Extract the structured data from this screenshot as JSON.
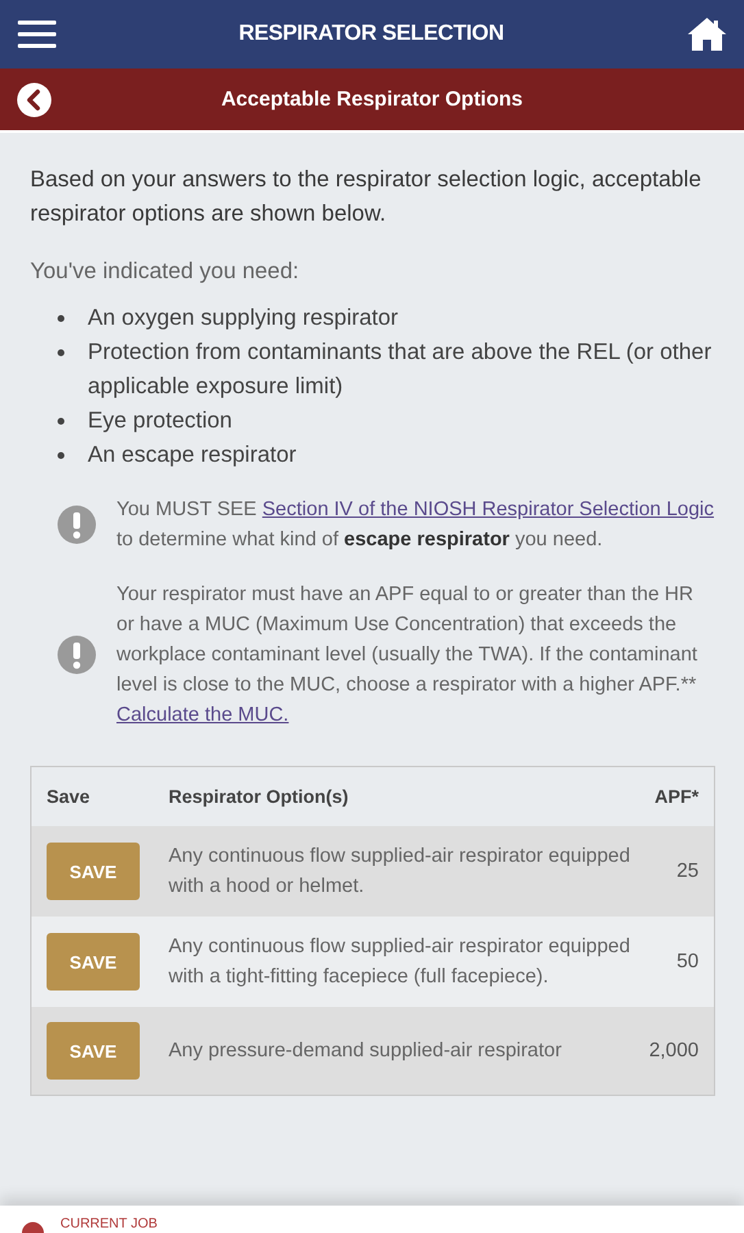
{
  "header": {
    "title": "RESPIRATOR SELECTION"
  },
  "subheader": {
    "title": "Acceptable Respirator Options"
  },
  "intro": "Based on your answers to the respirator selection logic, acceptable respirator options are shown below.",
  "needs_label": "You've indicated you need:",
  "needs": [
    "An oxygen supplying respirator",
    "Protection from contaminants that are above the REL (or other applicable exposure limit)",
    "Eye protection",
    "An escape respirator"
  ],
  "notes": [
    {
      "segments": [
        {
          "kind": "plain",
          "text": "You MUST SEE "
        },
        {
          "kind": "link",
          "text": "Section IV of the NIOSH Respirator Selection Logic"
        },
        {
          "kind": "plain",
          "text": " to determine what kind of "
        },
        {
          "kind": "bold",
          "text": "escape respirator"
        },
        {
          "kind": "plain",
          "text": " you need."
        }
      ]
    },
    {
      "segments": [
        {
          "kind": "plain",
          "text": "Your respirator must have an APF equal to or greater than the HR or have a MUC (Maximum Use Concentration) that exceeds the workplace contaminant level (usually the TWA). If the contaminant level is close to the MUC, choose a respirator with a higher APF.** "
        },
        {
          "kind": "link",
          "text": "Calculate the MUC."
        }
      ]
    }
  ],
  "table": {
    "columns": [
      "Save",
      "Respirator Option(s)",
      "APF*"
    ],
    "rows": [
      {
        "button": "SAVE",
        "option": "Any continuous flow supplied-air respirator equipped with a hood or helmet.",
        "apf": "25"
      },
      {
        "button": "SAVE",
        "option": "Any continuous flow supplied-air respirator equipped with a tight-fitting facepiece (full facepiece).",
        "apf": "50"
      },
      {
        "button": "SAVE",
        "option": "Any pressure-demand supplied-air respirator",
        "apf": "2,000"
      }
    ]
  },
  "footer": {
    "label": "CURRENT JOB"
  }
}
